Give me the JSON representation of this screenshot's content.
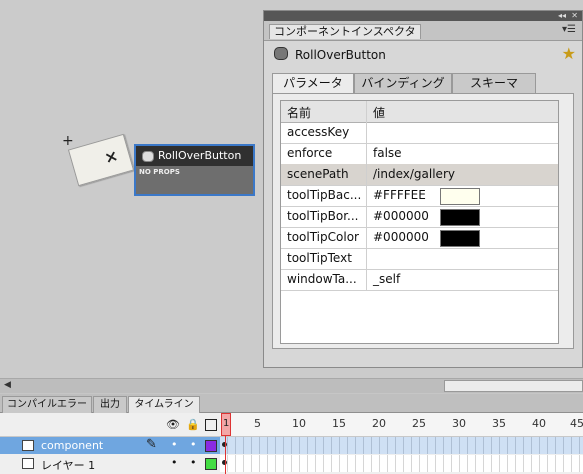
{
  "stage": {
    "component_label": "RollOverButton",
    "noprops_label": "NO PROPS",
    "placeholder_glyph": "×"
  },
  "inspector": {
    "panel_title": "コンポーネントインスペクタ",
    "component_name": "RollOverButton",
    "tabs": [
      "パラメータ",
      "バインディング",
      "スキーマ"
    ],
    "headers": {
      "name": "名前",
      "value": "値"
    },
    "rows": [
      {
        "name": "accessKey",
        "value": ""
      },
      {
        "name": "enforce",
        "value": "false"
      },
      {
        "name": "scenePath",
        "value": "/index/gallery",
        "selected": true
      },
      {
        "name": "toolTipBac...",
        "value": "#FFFFEE",
        "swatch": "#FFFFEE"
      },
      {
        "name": "toolTipBor...",
        "value": "#000000",
        "swatch": "#000000"
      },
      {
        "name": "toolTipColor",
        "value": "#000000",
        "swatch": "#000000"
      },
      {
        "name": "toolTipText",
        "value": ""
      },
      {
        "name": "windowTa...",
        "value": "_self"
      }
    ]
  },
  "bottom_panel": {
    "tabs": [
      "コンパイルエラー",
      "出力",
      "タイムライン"
    ],
    "active_tab": "タイムライン"
  },
  "timeline": {
    "frame_numbers": [
      "1",
      "5",
      "10",
      "15",
      "20",
      "25",
      "30",
      "35",
      "40",
      "45"
    ],
    "current_frame": "1",
    "layers": [
      {
        "name": "component",
        "selected": true,
        "color": "#8a2be2"
      },
      {
        "name": "レイヤー 1",
        "selected": false,
        "color": "#44dd44"
      }
    ]
  },
  "colors": {
    "accent": "#3b78c8",
    "selected_layer": "#6fa6e0",
    "playhead": "#dd3333"
  }
}
